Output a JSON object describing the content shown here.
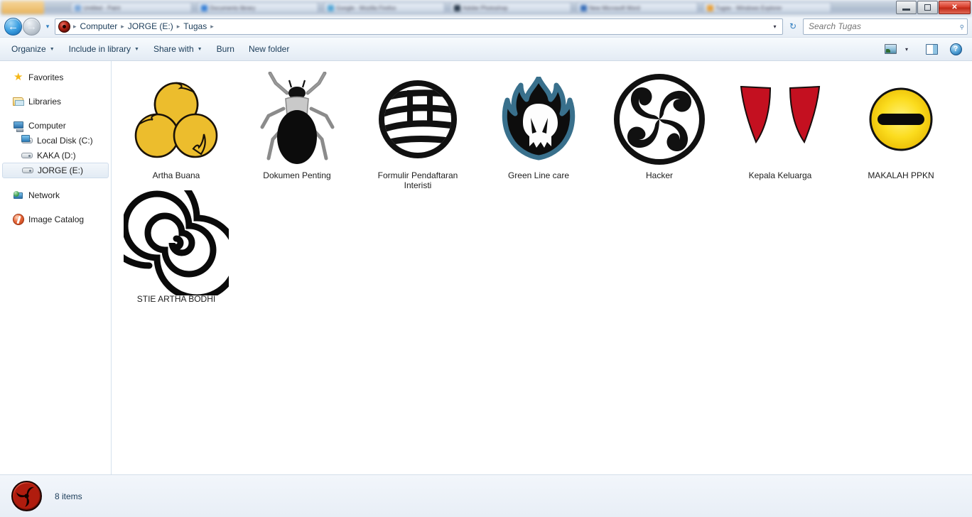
{
  "window": {
    "controls": {
      "minimize": "minimize-button",
      "restore": "restore-button",
      "close_label": "✕"
    }
  },
  "taskbar": {
    "items": [
      {
        "label": "Untitled - Paint",
        "color": "#7fa9d9"
      },
      {
        "label": "Documents library",
        "color": "#3b82d6"
      },
      {
        "label": "Google - Mozilla Firefox",
        "color": "#55a7d6"
      },
      {
        "label": "Adobe Photoshop",
        "color": "#2b3b4d"
      },
      {
        "label": "New Microsoft Word",
        "color": "#3b6fb8"
      },
      {
        "label": "Tugas - Windows Explorer",
        "color": "#e8a13c"
      }
    ]
  },
  "addressbar": {
    "back_glyph": "←",
    "forward_glyph": "→",
    "history_glyph": "▾",
    "breadcrumb_icon": "folder-sharingan-icon",
    "crumbs": [
      "Computer",
      "JORGE (E:)",
      "Tugas"
    ],
    "separator": "▸",
    "dropdown_glyph": "▾",
    "refresh_glyph": "↻"
  },
  "search": {
    "placeholder": "Search Tugas",
    "value": "",
    "icon": "search-icon"
  },
  "toolbar": {
    "buttons": [
      {
        "label": "Organize",
        "has_caret": true
      },
      {
        "label": "Include in library",
        "has_caret": true
      },
      {
        "label": "Share with",
        "has_caret": true
      },
      {
        "label": "Burn",
        "has_caret": false
      },
      {
        "label": "New folder",
        "has_caret": false
      }
    ],
    "view_caret": "▾",
    "help_label": "?"
  },
  "sidebar": {
    "items": [
      {
        "label": "Favorites",
        "icon": "star-icon",
        "level": 0,
        "selected": false,
        "gap_after": true
      },
      {
        "label": "Libraries",
        "icon": "library-folder-icon",
        "level": 0,
        "selected": false,
        "gap_after": true
      },
      {
        "label": "Computer",
        "icon": "computer-icon",
        "level": 0,
        "selected": false,
        "gap_after": false
      },
      {
        "label": "Local Disk (C:)",
        "icon": "hard-disk-system-icon",
        "level": 1,
        "selected": false,
        "gap_after": false
      },
      {
        "label": "KAKA (D:)",
        "icon": "hard-disk-icon",
        "level": 1,
        "selected": false,
        "gap_after": false
      },
      {
        "label": "JORGE (E:)",
        "icon": "hard-disk-icon",
        "level": 1,
        "selected": true,
        "gap_after": true
      },
      {
        "label": "Network",
        "icon": "network-icon",
        "level": 0,
        "selected": false,
        "gap_after": true
      },
      {
        "label": "Image Catalog",
        "icon": "image-catalog-icon",
        "level": 0,
        "selected": false,
        "gap_after": false
      }
    ]
  },
  "files": [
    {
      "name": "Artha Buana",
      "icon": "three-gold-tomoe-icon"
    },
    {
      "name": "Dokumen Penting",
      "icon": "beetle-icon"
    },
    {
      "name": "Formulir Pendaftaran Interisti",
      "icon": "striped-globe-icon"
    },
    {
      "name": "Green Line care",
      "icon": "flaming-skull-icon"
    },
    {
      "name": "Hacker",
      "icon": "four-arm-swirl-icon"
    },
    {
      "name": "Kepala Keluarga",
      "icon": "red-fangs-icon"
    },
    {
      "name": "MAKALAH PPKN",
      "icon": "yellow-circle-bar-icon"
    },
    {
      "name": "STIE ARTHA BODHI",
      "icon": "black-spiral-icon"
    }
  ],
  "statusbar": {
    "icon": "folder-sharingan-icon",
    "item_count": "8 items"
  },
  "colors": {
    "gold": "#ecbd2d",
    "red": "#c41020",
    "teal": "#39708c",
    "black": "#111111",
    "yellow": "#fbdc1e",
    "text": "#1b3c59"
  }
}
